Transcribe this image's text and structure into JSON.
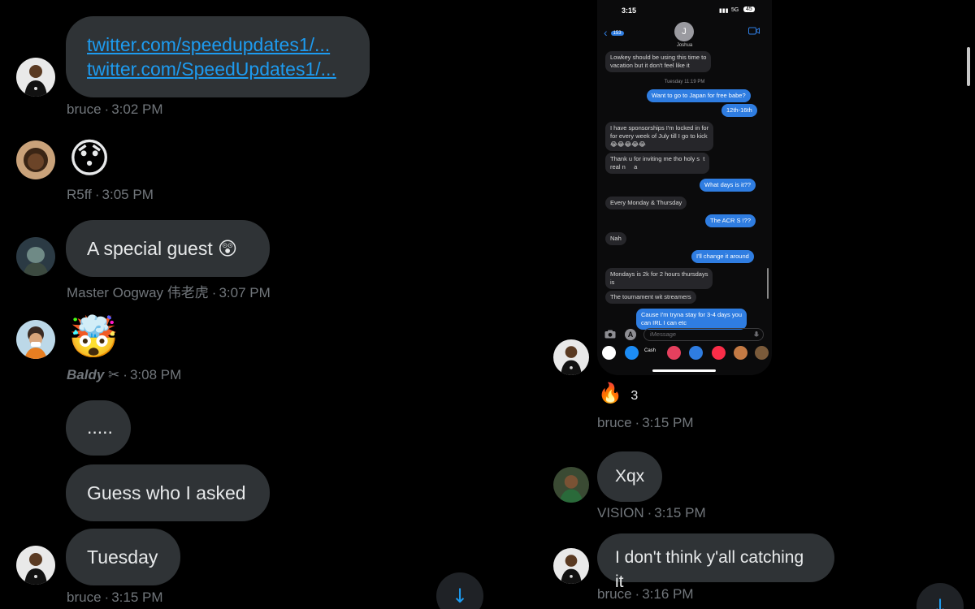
{
  "left": {
    "messages": [
      {
        "type": "links",
        "links": [
          "twitter.com/speedupdates1/...",
          "twitter.com/SpeedUpdates1/..."
        ],
        "author": "bruce",
        "time": "3:02 PM"
      },
      {
        "type": "emoji",
        "emoji": "😯",
        "author": "R5ff",
        "time": "3:05 PM"
      },
      {
        "type": "text",
        "text": "A special guest 😲",
        "author": "Master Oogway 伟老虎",
        "time": "3:07 PM"
      },
      {
        "type": "emoji",
        "emoji": "🤯",
        "author": "Baldy ✂",
        "time": "3:08 PM"
      },
      {
        "type": "text",
        "text": "....."
      },
      {
        "type": "text",
        "text": "Guess who I asked"
      },
      {
        "type": "text",
        "text": "Tuesday",
        "author": "bruce",
        "time": "3:15 PM"
      }
    ]
  },
  "right": {
    "phone": {
      "status_time": "3:15",
      "status_signal": "5G",
      "status_battery": "45",
      "back_count": "153",
      "contact_initial": "J",
      "contact_name": "Joshua",
      "messages": [
        {
          "dir": "in",
          "text": "Lowkey should be using this time to\nvacation but it don't feel like it"
        },
        {
          "dir": "day",
          "text": "Tuesday 11:19 PM"
        },
        {
          "dir": "out",
          "text": "Want to go to Japan for free babe?"
        },
        {
          "dir": "out",
          "text": "12th-16th"
        },
        {
          "dir": "in",
          "text": "I have sponsorships I'm locked in for\nfor every week of July till I go to kick\n😂😂😂😂😂"
        },
        {
          "dir": "in",
          "text": "Thank u for inviting me tho holy s  t\nreal n     a"
        },
        {
          "dir": "out",
          "text": "What days is it??"
        },
        {
          "dir": "in",
          "text": "Every Monday & Thursday"
        },
        {
          "dir": "out",
          "text": "The ACR S   !??"
        },
        {
          "dir": "in",
          "text": "Nah"
        },
        {
          "dir": "out",
          "text": "I'll change it around"
        },
        {
          "dir": "in",
          "text": "Mondays is 2k for 2 hours thursdays\nis"
        },
        {
          "dir": "in",
          "text": "The tournament wit streamers"
        },
        {
          "dir": "out",
          "text": "Cause I'm tryna stay for 3-4 days you\ncan IRL I can etc"
        }
      ],
      "input_placeholder": "iMessage",
      "cash_label": "Cash"
    },
    "reaction_emoji": "🔥",
    "reaction_count": "3",
    "phone_author": "bruce",
    "phone_time": "3:15 PM",
    "messages": [
      {
        "text": "Xqx",
        "author": "VISION",
        "time": "3:15 PM"
      },
      {
        "text": "I don't think y'all catching it",
        "author": "bruce",
        "time": "3:16 PM"
      }
    ]
  },
  "icons": {
    "scroll_down": "↓",
    "back": "‹",
    "video": "video-icon",
    "camera": "camera-icon",
    "mic": "mic-icon"
  },
  "colors": {
    "bubble": "#2f3336",
    "link": "#1d9bf0",
    "meta": "#71767b",
    "imessage_blue": "#2f7de1"
  }
}
